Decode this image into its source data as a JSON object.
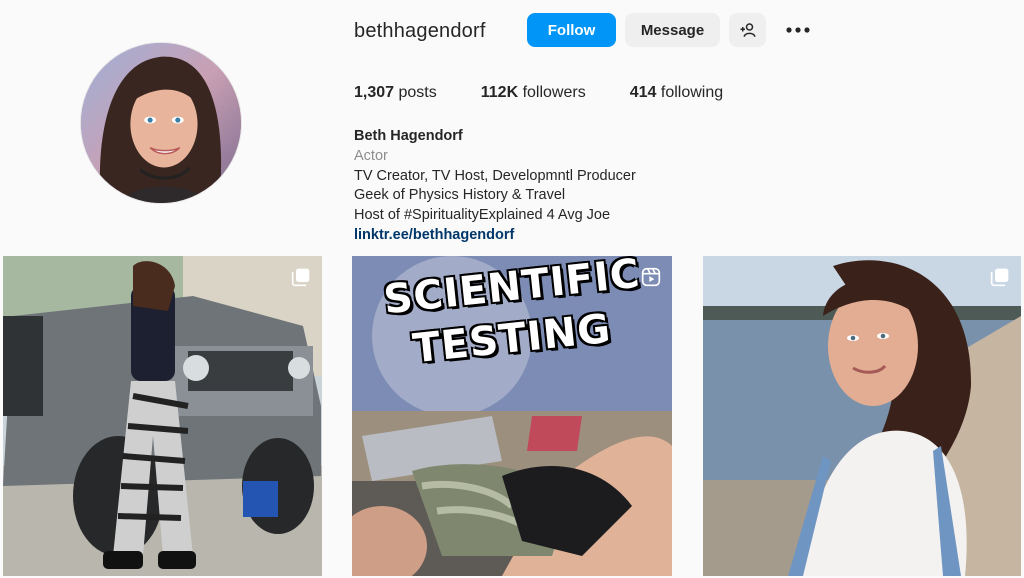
{
  "profile": {
    "username": "bethhagendorf",
    "follow_label": "Follow",
    "message_label": "Message",
    "posts_count": "1,307",
    "posts_label": "posts",
    "followers_count": "112K",
    "followers_label": "followers",
    "following_count": "414",
    "following_label": "following",
    "display_name": "Beth Hagendorf",
    "category": "Actor",
    "bio_lines": [
      "TV Creator, TV Host, Developmntl Producer",
      "Geek of Physics History & Travel",
      "Host of #SpiritualityExplained 4 Avg Joe"
    ],
    "link": "linktr.ee/bethhagendorf"
  },
  "icons": {
    "add_user": "person-add-icon",
    "more": "more-options-icon",
    "carousel": "carousel-icon",
    "reel": "reel-icon"
  },
  "colors": {
    "follow_bg": "#0095f6",
    "secondary_btn_bg": "#efefef",
    "link": "#00376b",
    "muted": "#8e8e8e"
  },
  "posts": [
    {
      "kind": "carousel"
    },
    {
      "kind": "reel",
      "overlay_line1": "SCIENTIFIC",
      "overlay_line2": "TESTING"
    },
    {
      "kind": "carousel"
    }
  ]
}
